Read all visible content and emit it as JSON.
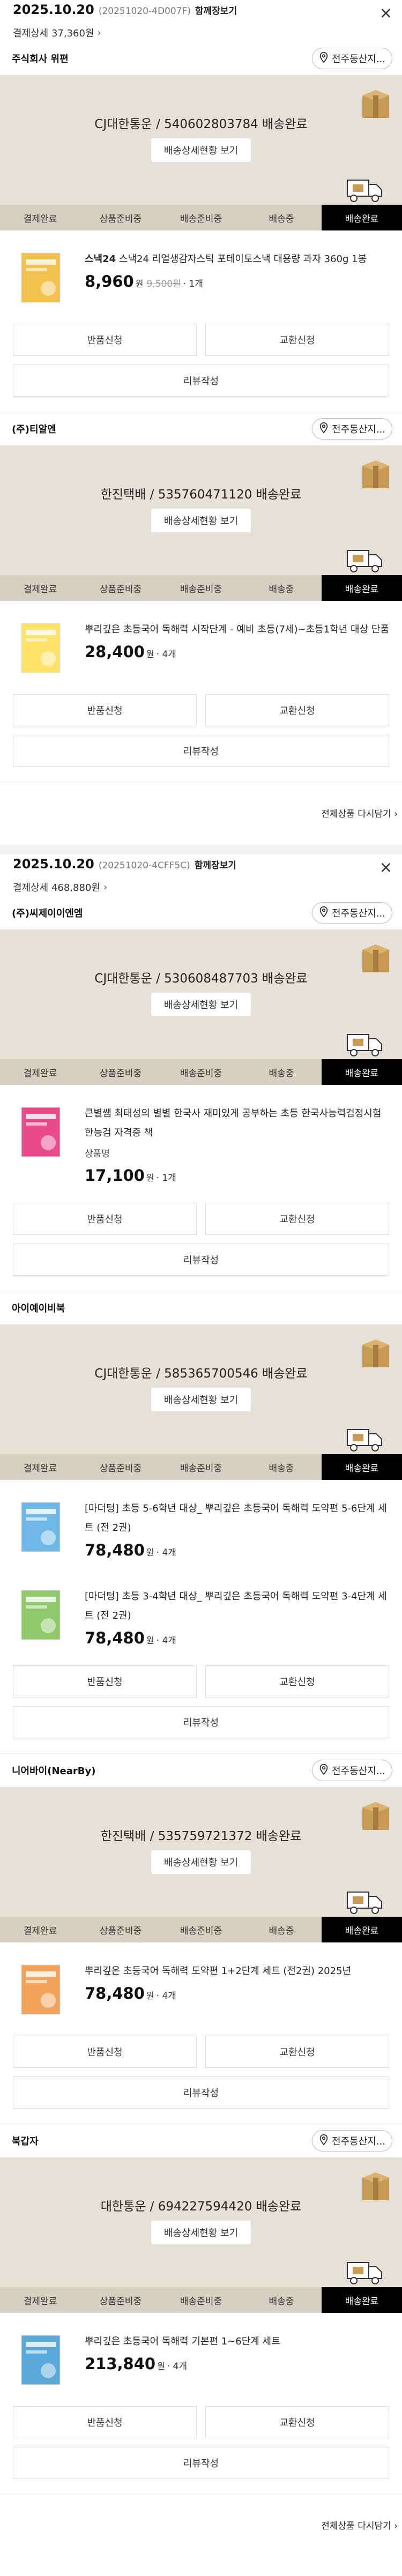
{
  "order1": {
    "date": "2025.10.20",
    "order_id": "(20251020-4D007F)",
    "together_label": "함께장보기",
    "payment_detail": "결제상세 37,360원",
    "sellers": [
      {
        "name": "주식회사 위편",
        "store_btn": "전주동산지...",
        "courier": "CJ대한통운 / 540602803784 배송완료",
        "track_btn": "배송상세현황 보기",
        "items": [
          {
            "brand": "스낵24",
            "title": "스낵24 리얼생감자스틱 포테이토스낵 대용량 과자 360g 1봉",
            "option": "",
            "price": "8,960",
            "won": "원",
            "orig": "9,500원",
            "qty": "· 1개"
          }
        ]
      },
      {
        "name": "(주)티알엔",
        "store_btn": "전주동산지...",
        "courier": "한진택배 / 535760471120 배송완료",
        "track_btn": "배송상세현황 보기",
        "items": [
          {
            "brand": "",
            "title": "뿌리깊은 초등국어 독해력 시작단계 - 예비 초등(7세)~초등1학년 대상 단품",
            "option": "",
            "price": "28,400",
            "won": "원",
            "orig": "",
            "qty": "· 4개"
          }
        ]
      }
    ],
    "all_items_label": "전체상품 다시담기 ›"
  },
  "order2": {
    "date": "2025.10.20",
    "order_id": "(20251020-4CFF5C)",
    "together_label": "함께장보기",
    "payment_detail": "결제상세 468,880원",
    "sellers": [
      {
        "name": "(주)씨제이이엔엠",
        "store_btn": "전주동산지...",
        "courier": "CJ대한통운 / 530608487703 배송완료",
        "track_btn": "배송상세현황 보기",
        "items": [
          {
            "brand": "",
            "title": "큰별쌤 최태성의 별별 한국사 재미있게 공부하는 초등 한국사능력검정시험 한능검 자격증 책",
            "option": "상품명",
            "price": "17,100",
            "won": "원",
            "orig": "",
            "qty": "· 1개"
          }
        ]
      },
      {
        "name": "아이예이비북",
        "store_btn": "",
        "courier": "CJ대한통운 / 585365700546 배송완료",
        "track_btn": "배송상세현황 보기",
        "items": [
          {
            "brand": "",
            "title": "[마더텅] 초등 5-6학년 대상_ 뿌리깊은 초등국어 독해력 도약편 5-6단계 세트 (전 2권)",
            "option": "",
            "price": "78,480",
            "won": "원",
            "orig": "",
            "qty": "· 4개"
          },
          {
            "brand": "",
            "title": "[마더텅] 초등 3-4학년 대상_ 뿌리깊은 초등국어 독해력 도약편 3-4단계 세트 (전 2권)",
            "option": "",
            "price": "78,480",
            "won": "원",
            "orig": "",
            "qty": "· 4개"
          }
        ]
      },
      {
        "name": "니어바이(NearBy)",
        "store_btn": "전주동산지...",
        "courier": "한진택배 / 535759721372 배송완료",
        "track_btn": "배송상세현황 보기",
        "items": [
          {
            "brand": "",
            "title": "뿌리깊은 초등국어 독해력 도약편 1+2단계 세트 (전2권) 2025년",
            "option": "",
            "price": "78,480",
            "won": "원",
            "orig": "",
            "qty": "· 4개"
          }
        ]
      },
      {
        "name": "북갑자",
        "store_btn": "전주동산지...",
        "courier": "대한통운 / 694227594420 배송완료",
        "track_btn": "배송상세현황 보기",
        "items": [
          {
            "brand": "",
            "title": "뿌리깊은 초등국어 독해력 기본편 1~6단계 세트",
            "option": "",
            "price": "213,840",
            "won": "원",
            "orig": "",
            "qty": "· 4개"
          }
        ]
      }
    ],
    "all_items_label": "전체상품 다시담기 ›"
  },
  "steps": [
    "결제완료",
    "상품준비중",
    "배송준비중",
    "배송중",
    "배송완료"
  ],
  "actions": {
    "return": "반품신청",
    "exchange": "교환신청",
    "review": "리뷰작성"
  },
  "close_icon": "×",
  "chevron": "›",
  "colors": {
    "shipbox_bg": "#e6e1d6",
    "stepbar_bg": "#d6d0c3",
    "active_step": "#000000"
  }
}
